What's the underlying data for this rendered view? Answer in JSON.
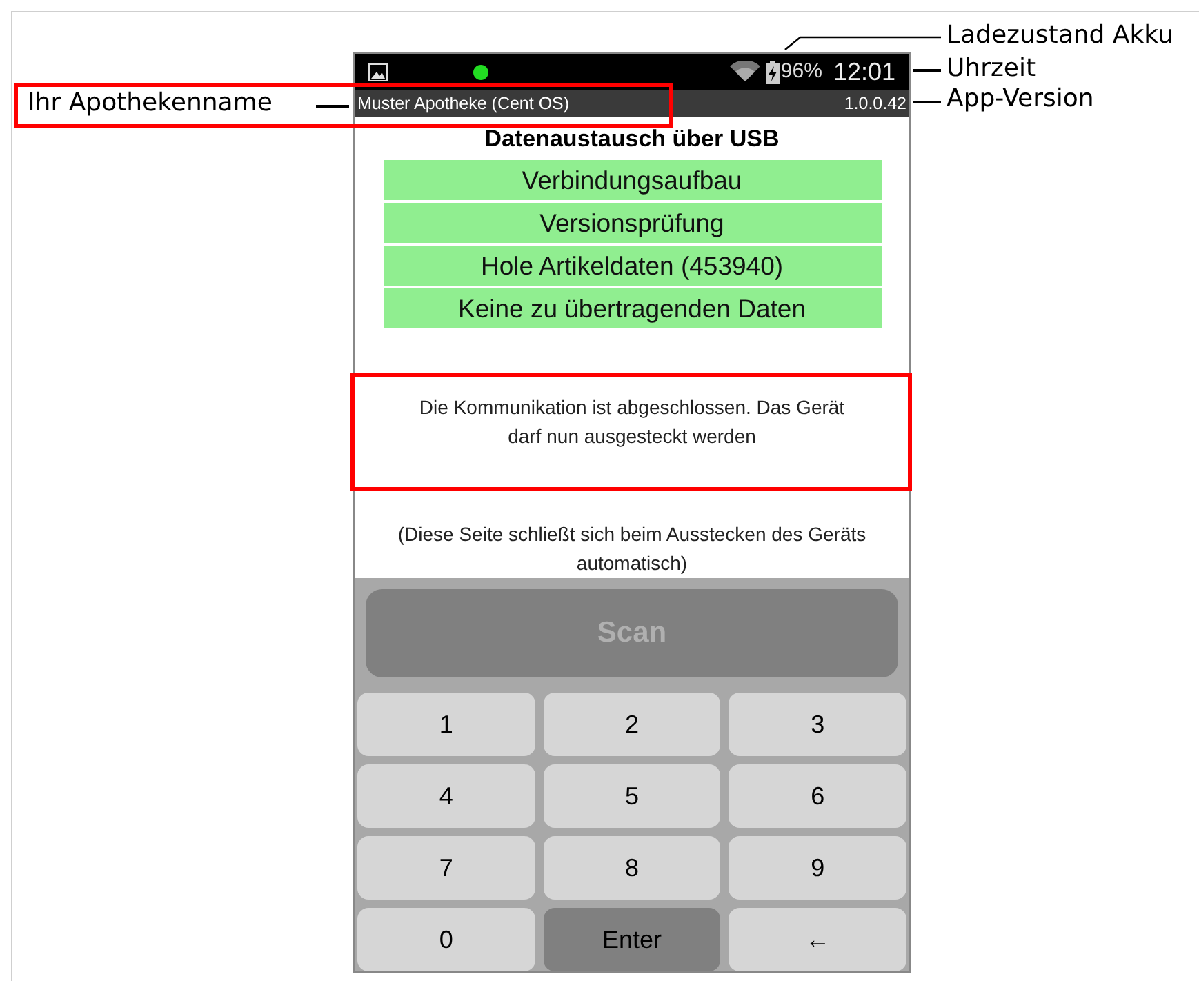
{
  "annotations": [
    {
      "label": "Ladezustand Akku"
    },
    {
      "label": "Uhrzeit"
    },
    {
      "label": "Ihr Apothekenname"
    },
    {
      "label": "App-Version"
    }
  ],
  "status_bar": {
    "battery": "96%",
    "time": "12:01"
  },
  "app_bar": {
    "pharmacy_name": "Muster Apotheke (Cent OS)",
    "version": "1.0.0.42"
  },
  "title": "Datenaustausch über USB",
  "steps": [
    "Verbindungsaufbau",
    "Versionsprüfung",
    "Hole Artikeldaten (453940)",
    "Keine zu übertragenden Daten"
  ],
  "message": "Die Kommunikation ist abgeschlossen. Das Gerät darf nun ausgesteckt werden",
  "note": "(Diese Seite schließt sich beim Ausstecken des Geräts automatisch)",
  "scan_button": {
    "label": "Scan",
    "disabled": true
  },
  "keys": [
    {
      "label": "1",
      "kind": "light"
    },
    {
      "label": "2",
      "kind": "light"
    },
    {
      "label": "3",
      "kind": "light"
    },
    {
      "label": "4",
      "kind": "light"
    },
    {
      "label": "5",
      "kind": "light"
    },
    {
      "label": "6",
      "kind": "light"
    },
    {
      "label": "7",
      "kind": "light"
    },
    {
      "label": "8",
      "kind": "light"
    },
    {
      "label": "9",
      "kind": "light"
    },
    {
      "label": "0",
      "kind": "light"
    },
    {
      "label": "Enter",
      "kind": "dark"
    },
    {
      "label": "←",
      "kind": "light"
    }
  ]
}
